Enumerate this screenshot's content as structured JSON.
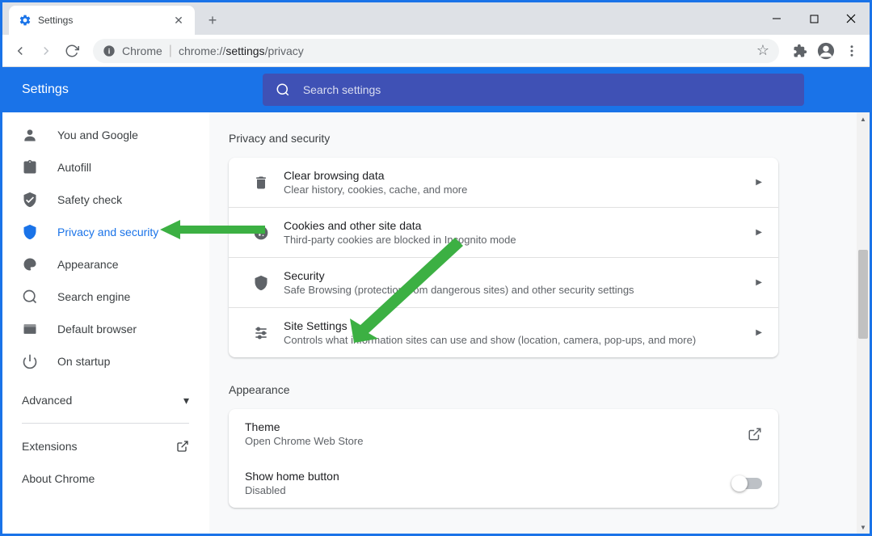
{
  "tab": {
    "title": "Settings"
  },
  "address": {
    "chrome_label": "Chrome",
    "url_prefix": "chrome://",
    "url_bold": "settings",
    "url_suffix": "/privacy"
  },
  "header": {
    "title": "Settings"
  },
  "search": {
    "placeholder": "Search settings"
  },
  "sidebar": {
    "items": [
      {
        "label": "You and Google"
      },
      {
        "label": "Autofill"
      },
      {
        "label": "Safety check"
      },
      {
        "label": "Privacy and security"
      },
      {
        "label": "Appearance"
      },
      {
        "label": "Search engine"
      },
      {
        "label": "Default browser"
      },
      {
        "label": "On startup"
      }
    ],
    "advanced": "Advanced",
    "extensions": "Extensions",
    "about": "About Chrome"
  },
  "privacy": {
    "title": "Privacy and security",
    "rows": [
      {
        "title": "Clear browsing data",
        "desc": "Clear history, cookies, cache, and more"
      },
      {
        "title": "Cookies and other site data",
        "desc": "Third-party cookies are blocked in Incognito mode"
      },
      {
        "title": "Security",
        "desc": "Safe Browsing (protection from dangerous sites) and other security settings"
      },
      {
        "title": "Site Settings",
        "desc": "Controls what information sites can use and show (location, camera, pop-ups, and more)"
      }
    ]
  },
  "appearance": {
    "title": "Appearance",
    "theme": {
      "title": "Theme",
      "desc": "Open Chrome Web Store"
    },
    "home": {
      "title": "Show home button",
      "desc": "Disabled"
    }
  }
}
